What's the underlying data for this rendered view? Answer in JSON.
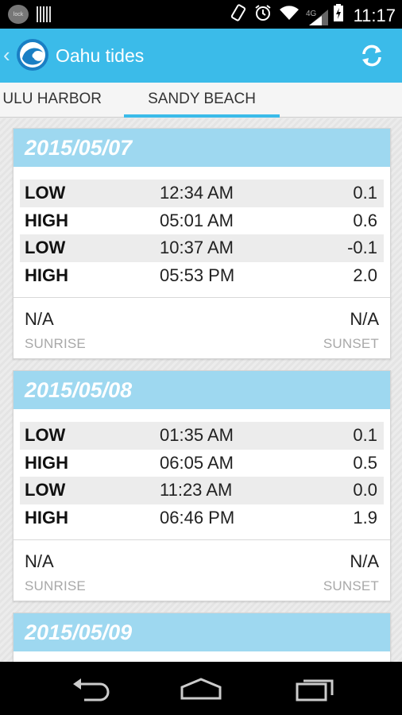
{
  "status_bar": {
    "lock_text": "lock",
    "network_label": "4G",
    "time": "11:17"
  },
  "action_bar": {
    "back_glyph": "‹",
    "title": "Oahu tides",
    "refresh_icon": "refresh-icon"
  },
  "tabs": [
    {
      "label": "HONOLULU HARBOR",
      "visible_label": "ULU HARBOR",
      "selected": false
    },
    {
      "label": "SANDY BEACH",
      "selected": true
    }
  ],
  "cards": [
    {
      "date": "2015/05/07",
      "tides": [
        {
          "type": "LOW",
          "time": "12:34 AM",
          "height": "0.1"
        },
        {
          "type": "HIGH",
          "time": "05:01 AM",
          "height": "0.6"
        },
        {
          "type": "LOW",
          "time": "10:37 AM",
          "height": "-0.1"
        },
        {
          "type": "HIGH",
          "time": "05:53 PM",
          "height": "2.0"
        }
      ],
      "sunrise": "N/A",
      "sunrise_label": "SUNRISE",
      "sunset": "N/A",
      "sunset_label": "SUNSET"
    },
    {
      "date": "2015/05/08",
      "tides": [
        {
          "type": "LOW",
          "time": "01:35 AM",
          "height": "0.1"
        },
        {
          "type": "HIGH",
          "time": "06:05 AM",
          "height": "0.5"
        },
        {
          "type": "LOW",
          "time": "11:23 AM",
          "height": "0.0"
        },
        {
          "type": "HIGH",
          "time": "06:46 PM",
          "height": "1.9"
        }
      ],
      "sunrise": "N/A",
      "sunrise_label": "SUNRISE",
      "sunset": "N/A",
      "sunset_label": "SUNSET"
    },
    {
      "date": "2015/05/09"
    }
  ],
  "colors": {
    "accent": "#3bbbe9",
    "card_header": "#9ed8f0",
    "row_shade": "#ececec"
  }
}
